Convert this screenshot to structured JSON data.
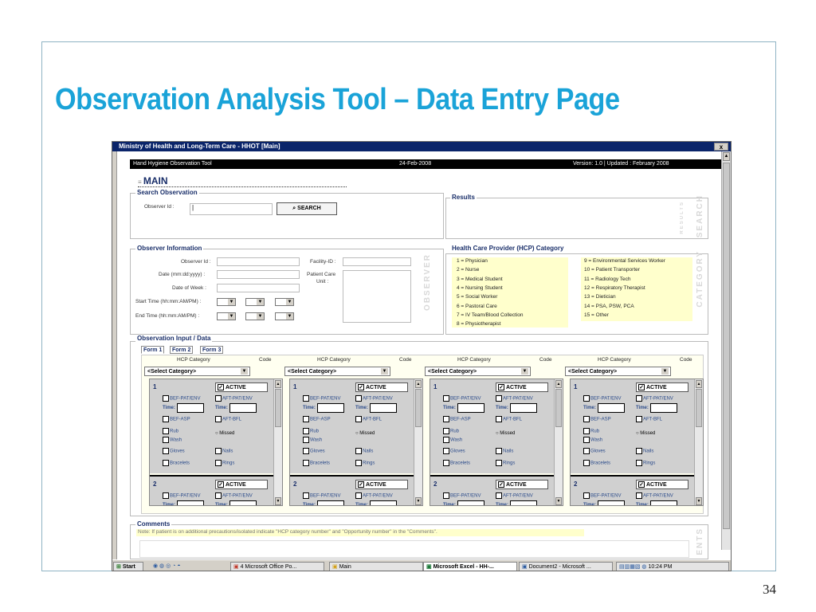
{
  "slide": {
    "title": "Observation Analysis Tool – Data Entry Page",
    "page_number": "34"
  },
  "window": {
    "title": "Ministry of Health and Long-Term Care - HHOT [Main]",
    "close": "x"
  },
  "header": {
    "app": "Hand Hygiene Observation Tool",
    "date": "24-Feb-2008",
    "version": "Version: 1.0   |   Updated : February 2008"
  },
  "main": {
    "label": "MAIN"
  },
  "search": {
    "title": "Search Observation",
    "observer_label": "Observer Id :",
    "observer_value": "|",
    "button": "SEARCH",
    "results_title": "Results",
    "wm_results": "RESULTS",
    "wm_search": "SEARCH"
  },
  "observer": {
    "title": "Observer Information",
    "observer_id": "Observer Id :",
    "date": "Date (mm:dd:yyyy) :",
    "day": "Date of Week :",
    "start": "Start Time (hh:mm:AM/PM) :",
    "end": "End Time (hh:mm:AM/PM) :",
    "facility": "Facility-ID :",
    "patient_care": "Patient Care",
    "unit": "Unit :",
    "wm": "OBSERVER"
  },
  "hcp": {
    "title": "Health Care Provider (HCP) Category",
    "left": [
      "1 = Physician",
      "2 = Nurse",
      "3 = Medical Student",
      "4 = Nursing Student",
      "5 = Social Worker",
      "6 = Pastoral Care",
      "7 = IV Team/Blood Collection",
      "8 = Physiotherapist"
    ],
    "right": [
      "9 = Environmental Services Worker",
      "10 = Patient Transporter",
      "11 = Radiology Tech",
      "12 = Respiratory Therapist",
      "13 = Dietician",
      "14 = PSA, PSW, PCA",
      "15 = Other"
    ],
    "wm": "CATEGORY"
  },
  "input": {
    "title": "Observation Input / Data",
    "tabs": [
      "Form 1",
      "Form 2",
      "Form 3"
    ],
    "col_hcp": "HCP Category",
    "col_code": "Code",
    "select": "<Select Category>",
    "panel": {
      "n1": "1",
      "n2": "2",
      "active": "ACTIVE",
      "bef_pat": "BEF-PAT/ENV",
      "aft_pat": "AFT-PAT/ENV",
      "time": "Time:",
      "bef_asp": "BEF-ASP",
      "aft_bfl": "AFT-BFL",
      "rub": "Rub",
      "wash": "Wash",
      "missed": "Missed",
      "gloves": "Gloves",
      "nails": "Nails",
      "bracelets": "Bracelets",
      "rings": "Rings"
    }
  },
  "comments": {
    "title": "Comments",
    "note": "Note: If patient is on additional precautions/isolated indicate \"HCP category number\" and \"Opportunity number\" in the \"Comments\".",
    "wm": "ENTS"
  },
  "taskbar": {
    "start": "Start",
    "items": [
      "4 Microsoft Office Po...",
      "Main",
      "Microsoft Excel - HH-...",
      "Document2 - Microsoft ..."
    ],
    "clock": "10:24 PM"
  }
}
